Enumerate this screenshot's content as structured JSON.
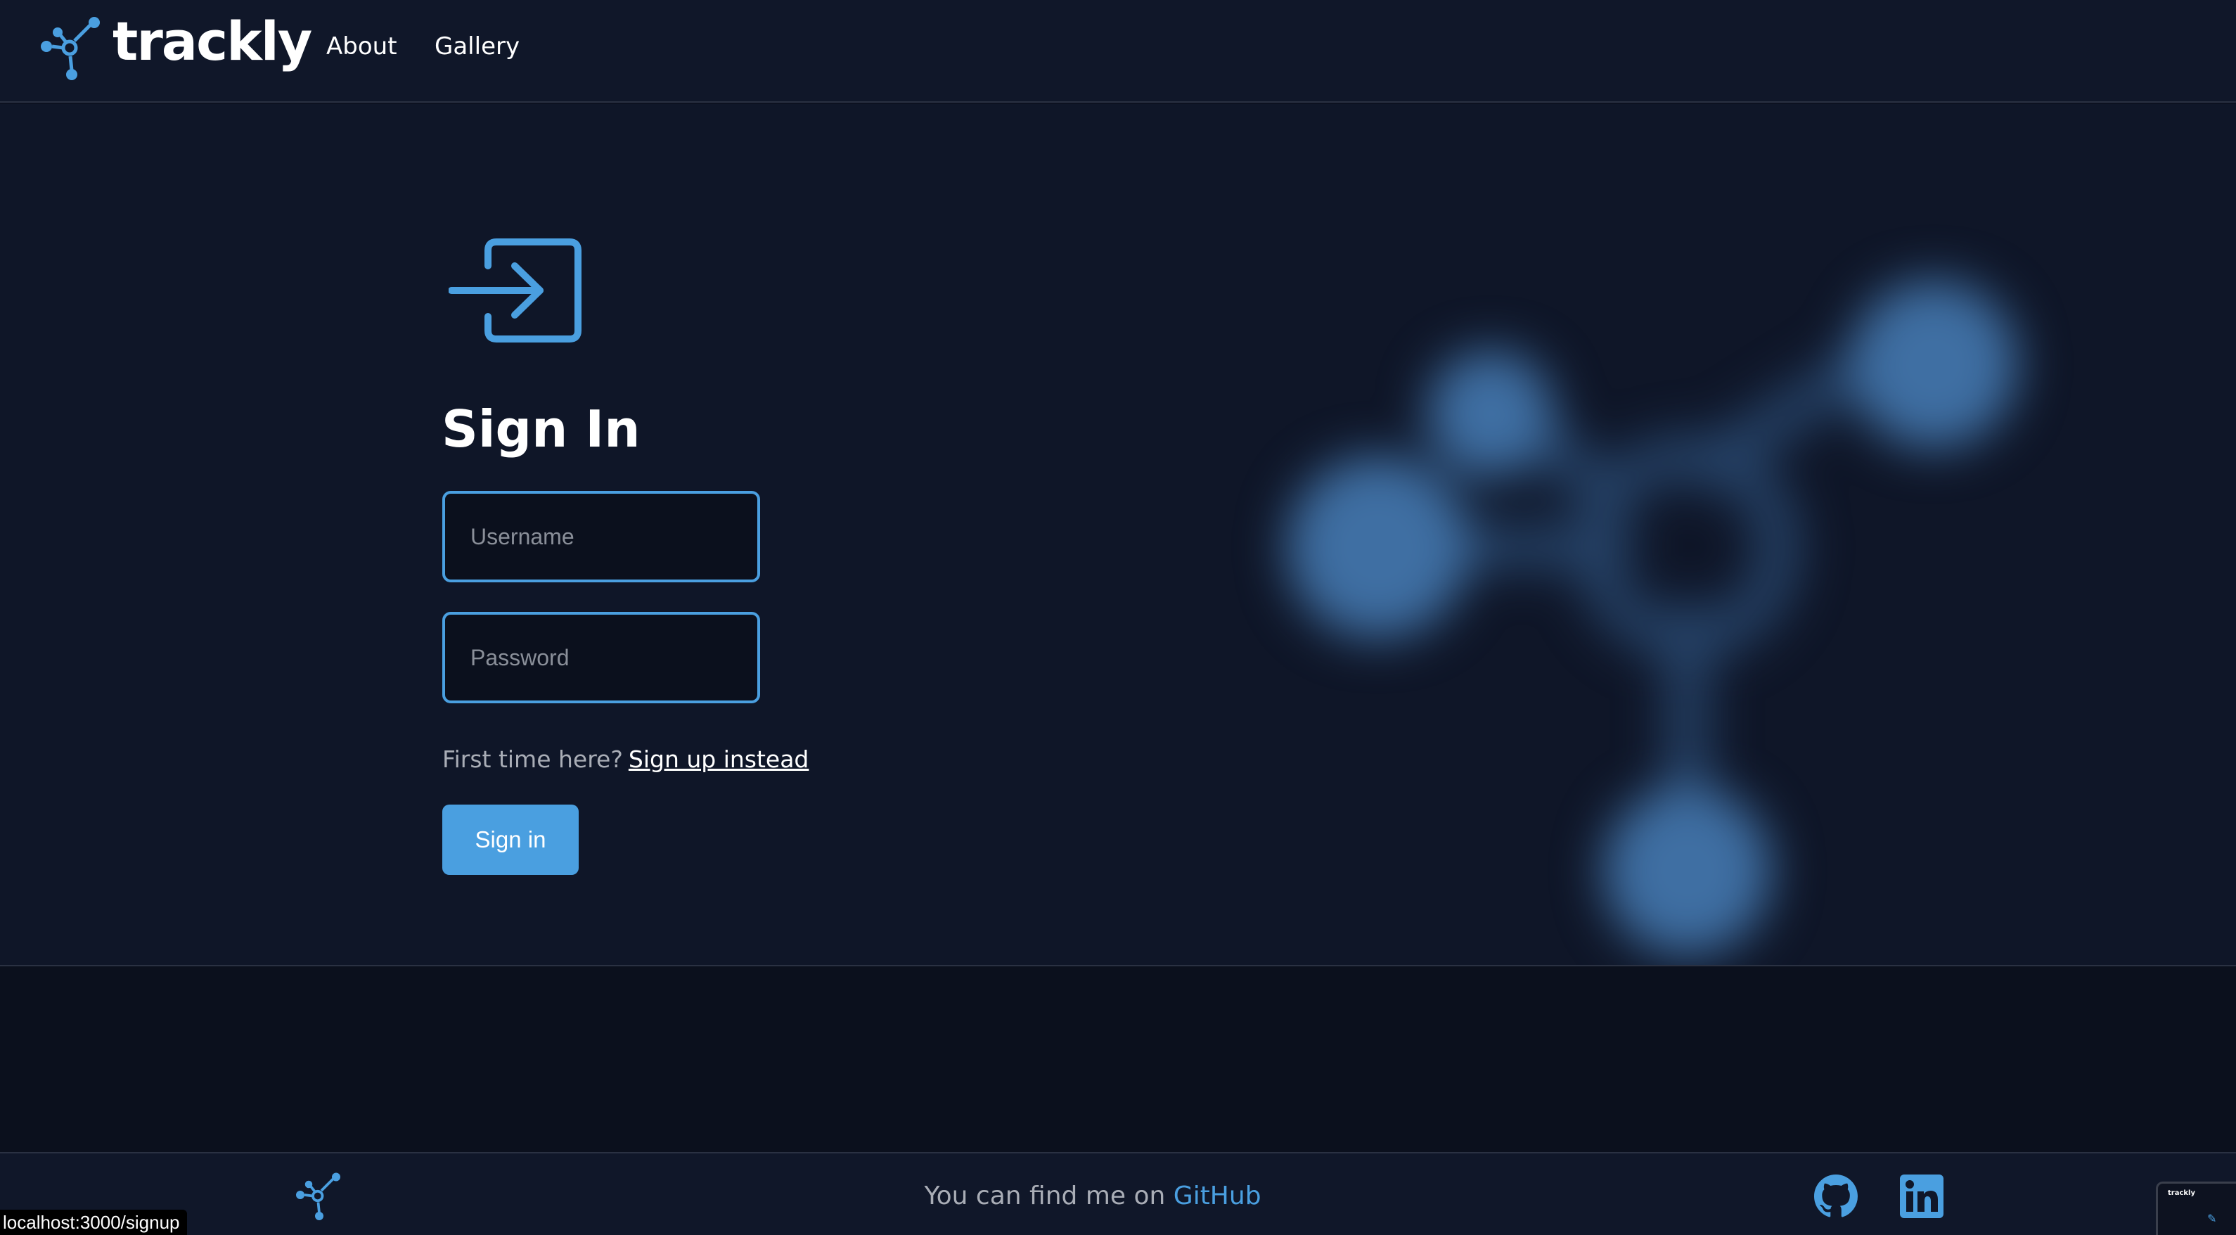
{
  "header": {
    "brand": "trackly",
    "nav": [
      {
        "label": "About"
      },
      {
        "label": "Gallery"
      }
    ]
  },
  "signin": {
    "title": "Sign In",
    "username_placeholder": "Username",
    "password_placeholder": "Password",
    "prompt": "First time here?",
    "signup_link": "Sign up instead",
    "button": "Sign in"
  },
  "footer": {
    "text": "You can find me on",
    "link": "GitHub"
  },
  "statusbar": {
    "url": "localhost:3000/signup"
  },
  "thumbnail": {
    "brand": "trackly"
  },
  "colors": {
    "accent": "#4a9fe0",
    "background": "#0f1628",
    "header": "#101729"
  },
  "icons": [
    "logo-icon",
    "signin-icon",
    "github-icon",
    "linkedin-icon",
    "pen-icon"
  ]
}
